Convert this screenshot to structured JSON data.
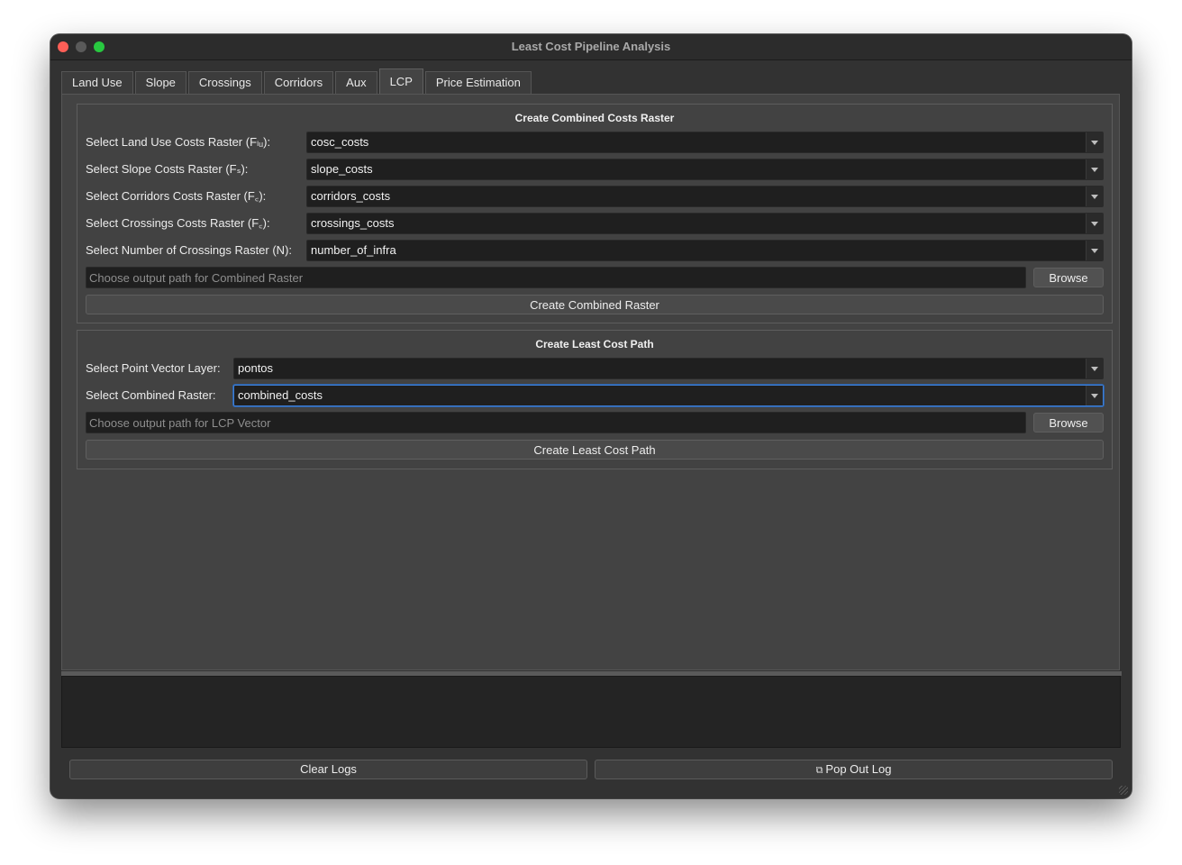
{
  "window": {
    "title": "Least Cost Pipeline Analysis"
  },
  "tabs": [
    {
      "label": "Land Use",
      "active": false
    },
    {
      "label": "Slope",
      "active": false
    },
    {
      "label": "Crossings",
      "active": false
    },
    {
      "label": "Corridors",
      "active": false
    },
    {
      "label": "Aux",
      "active": false
    },
    {
      "label": "LCP",
      "active": true
    },
    {
      "label": "Price Estimation",
      "active": false
    }
  ],
  "combined_group": {
    "title": "Create Combined Costs Raster",
    "rows": [
      {
        "label": "Select Land Use Costs Raster (Fₗᵤ):",
        "value": "cosc_costs"
      },
      {
        "label": "Select Slope Costs Raster (Fₛ):",
        "value": "slope_costs"
      },
      {
        "label": "Select Corridors Costs Raster (F꜀):",
        "value": "corridors_costs"
      },
      {
        "label": "Select Crossings Costs Raster (F꜀):",
        "value": "crossings_costs"
      },
      {
        "label": "Select Number of Crossings Raster (N):",
        "value": "number_of_infra"
      }
    ],
    "output_placeholder": "Choose output path for Combined Raster",
    "browse_label": "Browse",
    "create_label": "Create Combined Raster"
  },
  "lcp_group": {
    "title": "Create Least Cost Path",
    "rows": [
      {
        "label": "Select Point Vector Layer:",
        "value": "pontos"
      },
      {
        "label": "Select Combined Raster:",
        "value": "combined_costs"
      }
    ],
    "output_placeholder": "Choose output path for LCP Vector",
    "browse_label": "Browse",
    "create_label": "Create Least Cost Path"
  },
  "log": {
    "clear_label": "Clear Logs",
    "popout_icon": "popout-icon",
    "popout_label": "Pop Out Log"
  },
  "colors": {
    "window_bg": "#323232",
    "pane_bg": "#434343",
    "field_bg": "#1f1f1f",
    "focus": "#3f7fd6",
    "close": "#fe5f57",
    "maximize": "#28c840"
  }
}
